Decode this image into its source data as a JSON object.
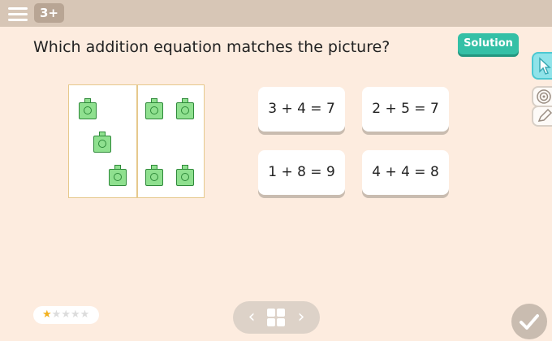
{
  "header": {
    "level_badge": "3+"
  },
  "question": {
    "text": "Which addition equation matches the picture?"
  },
  "solution_button": {
    "label": "Solution"
  },
  "answers": [
    {
      "label": "3 + 4 = 7"
    },
    {
      "label": "2 + 5 = 7"
    },
    {
      "label": "1 + 8 = 9"
    },
    {
      "label": "4 + 4 = 8"
    }
  ],
  "picture": {
    "left_group_count": 3,
    "right_group_count": 4
  },
  "rating": {
    "filled": 1,
    "total": 5
  },
  "navigation": {
    "prev_glyph": "‹",
    "next_glyph": "›"
  },
  "colors": {
    "accent": "#34c0a6",
    "block_fill": "#8fe08f",
    "block_stroke": "#2f8a3a",
    "star": "#f2b11f"
  },
  "icons": [
    "menu-icon",
    "grid-icon",
    "chevron-left-icon",
    "chevron-right-icon",
    "check-icon",
    "pointer-tool-icon",
    "target-tool-icon",
    "pencil-tool-icon",
    "star-icon"
  ]
}
